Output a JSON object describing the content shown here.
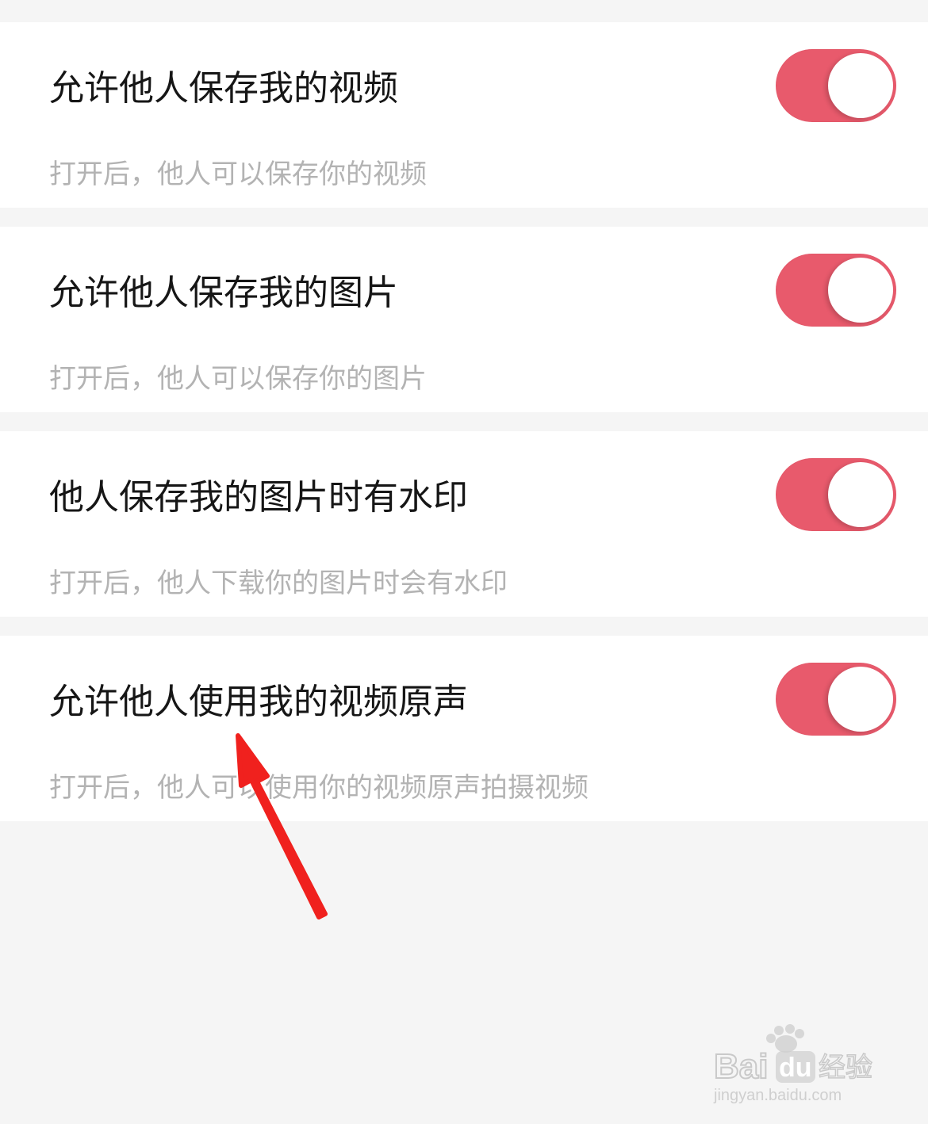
{
  "settings": [
    {
      "title": "允许他人保存我的视频",
      "description": "打开后，他人可以保存你的视频",
      "enabled": true
    },
    {
      "title": "允许他人保存我的图片",
      "description": "打开后，他人可以保存你的图片",
      "enabled": true
    },
    {
      "title": "他人保存我的图片时有水印",
      "description": "打开后，他人下载你的图片时会有水印",
      "enabled": true
    },
    {
      "title": "允许他人使用我的视频原声",
      "description": "打开后，他人可以使用你的视频原声拍摄视频",
      "enabled": true
    }
  ],
  "colors": {
    "toggle_on": "#e85a6c",
    "annotation_arrow": "#f0211e"
  },
  "watermark": {
    "brand": "Baidu经验",
    "url": "jingyan.baidu.com"
  }
}
